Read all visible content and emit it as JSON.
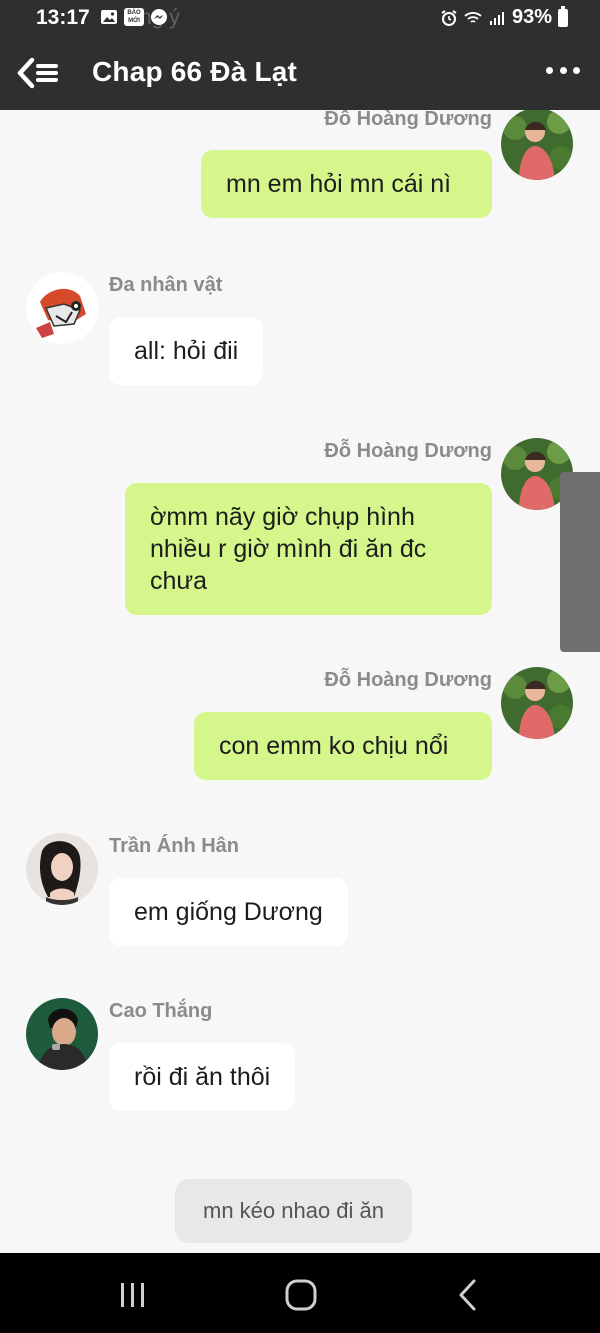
{
  "status_bar": {
    "time": "13:17",
    "ghost_text": "ng ý",
    "battery": "93%",
    "icons": [
      "image-icon",
      "baomoi-icon",
      "messenger-icon",
      "alarm-icon",
      "wifi-icon",
      "signal-icon",
      "battery-icon"
    ],
    "baomoi_label": "BÁO MỚI"
  },
  "header": {
    "title": "Chap 66 Đà Lạt",
    "back_icon": "back-menu-icon",
    "more_icon": "more-dots-icon"
  },
  "messages": [
    {
      "sender": "Đỗ Hoàng Dương",
      "text": "mn em hỏi mn cái nì",
      "direction": "outgoing"
    },
    {
      "sender": "Đa nhân vật",
      "text": "all: hỏi đii",
      "direction": "incoming"
    },
    {
      "sender": "Đỗ Hoàng Dương",
      "text": "ờmm nãy giờ chụp hình nhiều r giờ mình đi ăn đc chưa",
      "direction": "outgoing"
    },
    {
      "sender": "Đỗ Hoàng Dương",
      "text": "con emm ko chịu nổi",
      "direction": "outgoing"
    },
    {
      "sender": "Trần Ánh Hân",
      "text": "em giống Dương",
      "direction": "incoming"
    },
    {
      "sender": "Cao Thắng",
      "text": "rồi đi ăn thôi",
      "direction": "incoming"
    }
  ],
  "system_message": "mn kéo nhao đi ăn",
  "colors": {
    "header_bg": "#2f2f2f",
    "outgoing_bubble": "#d4f68b",
    "incoming_bubble": "#ffffff",
    "chat_bg": "#f7f7f7",
    "nav_bg": "#000000"
  },
  "nav_bar": {
    "icons": [
      "recent-apps-icon",
      "home-icon",
      "back-icon"
    ]
  }
}
